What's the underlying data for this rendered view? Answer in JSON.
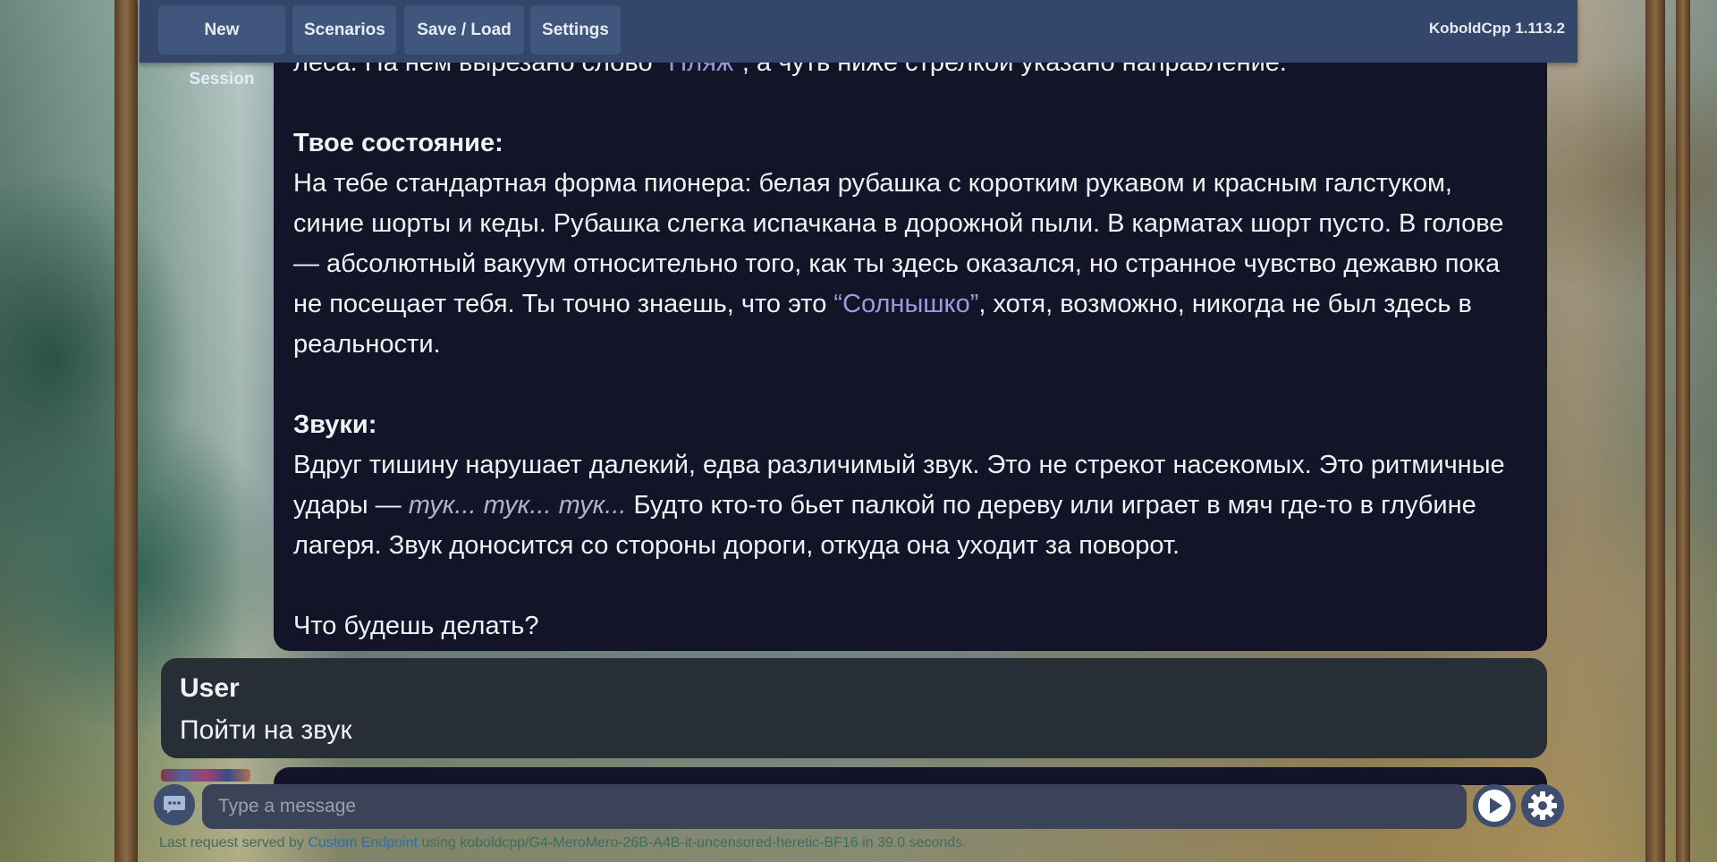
{
  "app": {
    "version": "KoboldCpp 1.113.2"
  },
  "topbar": {
    "buttons": [
      {
        "label": "New Session"
      },
      {
        "label": "Scenarios"
      },
      {
        "label": "Save / Load"
      },
      {
        "label": "Settings"
      }
    ]
  },
  "ai_message": {
    "clipped_line": {
      "before": "леса. На нем вырезано слово ",
      "highlight": "“Пляж”",
      "after": ", а чуть ниже стрелкой указано направление."
    },
    "state_heading": "Твое состояние:",
    "state_text_part1": "На тебе стандартная форма пионера: белая рубашка с коротким рукавом и красным галстуком, синие шорты и кеды. Рубашка слегка испачкана в дорожной пыли. В карматах шорт пусто. В голове — абсолютный вакуум относительно того, как ты здесь оказался, но странное чувство дежавю пока не посещает тебя. Ты точно знаешь, что это ",
    "state_highlight": "“Солнышко”",
    "state_text_part2": ", хотя, возможно, никогда не был здесь в реальности.",
    "sounds_heading": "Звуки:",
    "sounds_text_part1": "Вдруг тишину нарушает далекий, едва различимый звук. Это не стрекот насекомых. Это ритмичные удары — ",
    "sounds_italic": "тук... тук... тук...",
    "sounds_text_part2": " Будто кто-то бьет палкой по дереву или играет в мяч где-то в глубине лагеря. Звук доносится со стороны дороги, откуда она уходит за поворот.",
    "question": "Что будешь делать?"
  },
  "user_message": {
    "name": "User",
    "text": "Пойти на звук"
  },
  "input": {
    "placeholder": "Type a message"
  },
  "footer": {
    "prefix": "Last request served by ",
    "endpoint": "Custom Endpoint",
    "using": " using ",
    "model": "koboldcpp/G4-MeroMero-26B-A4B-it-uncensored-heretic-BF16",
    "time": " in 39.0 seconds."
  },
  "colors": {
    "topbar": "#34476a",
    "nav_button": "#41567c",
    "ai_bubble": "#131428",
    "user_bubble": "#272e36",
    "highlight": "#9b9bdf"
  },
  "icons": {
    "chat": "chat-bubble-icon",
    "send": "play-icon",
    "settings": "gear-icon"
  }
}
